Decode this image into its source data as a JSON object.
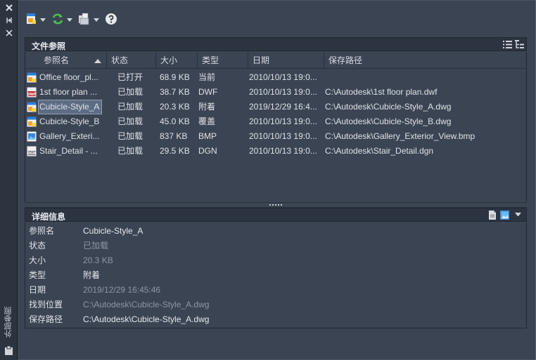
{
  "palette": {
    "vertical_title": "外部参照",
    "controls": [
      "close-icon",
      "auto-hide-icon",
      "properties-icon"
    ]
  },
  "toolbar": {
    "buttons": [
      "attach-icon",
      "refresh-icon",
      "change-path-icon",
      "help-icon"
    ]
  },
  "file_references": {
    "title": "文件参照",
    "columns": [
      "参照名",
      "状态",
      "大小",
      "类型",
      "日期",
      "保存路径"
    ],
    "sort_column": "参照名",
    "rows": [
      {
        "icon": "dwg-current-icon",
        "name": "Office floor_pl...",
        "status": "已打开",
        "size": "68.9 KB",
        "type": "当前",
        "date": "2010/10/13 19:0...",
        "path": ""
      },
      {
        "icon": "dwf-icon",
        "name": "1st floor plan ...",
        "status": "已加载",
        "size": "38.7 KB",
        "type": "DWF",
        "date": "2010/10/13 19:0...",
        "path": "C:\\Autodesk\\1st floor plan.dwf"
      },
      {
        "icon": "dwg-xref-icon",
        "name": "Cubicle-Style_A",
        "status": "已加载",
        "size": "20.3 KB",
        "type": "附着",
        "date": "2019/12/29 16:4...",
        "path": "C:\\Autodesk\\Cubicle-Style_A.dwg",
        "selected": true
      },
      {
        "icon": "dwg-xref-icon",
        "name": "Cubicle-Style_B",
        "status": "已加载",
        "size": "45.0 KB",
        "type": "覆盖",
        "date": "2010/10/13 19:0...",
        "path": "C:\\Autodesk\\Cubicle-Style_B.dwg"
      },
      {
        "icon": "image-icon",
        "name": "Gallery_Exteri...",
        "status": "已加载",
        "size": "837 KB",
        "type": "BMP",
        "date": "2010/10/13 19:0...",
        "path": "C:\\Autodesk\\Gallery_Exterior_View.bmp"
      },
      {
        "icon": "dgn-icon",
        "name": "Stair_Detail - ...",
        "status": "已加载",
        "size": "29.5 KB",
        "type": "DGN",
        "date": "2010/10/13 19:0...",
        "path": "C:\\Autodesk\\Stair_Detail.dgn"
      }
    ]
  },
  "details": {
    "title": "详细信息",
    "rows": [
      {
        "label": "参照名",
        "value": "Cubicle-Style_A",
        "style": "bright"
      },
      {
        "label": "状态",
        "value": "已加载",
        "style": "dim"
      },
      {
        "label": "大小",
        "value": "20.3 KB",
        "style": "dim"
      },
      {
        "label": "类型",
        "value": "附着",
        "style": "bright"
      },
      {
        "label": "日期",
        "value": "2019/12/29 16:45:46",
        "style": "dim"
      },
      {
        "label": "找到位置",
        "value": "C:\\Autodesk\\Cubicle-Style_A.dwg",
        "style": "dim"
      },
      {
        "label": "保存路径",
        "value": "C:\\Autodesk\\Cubicle-Style_A.dwg",
        "style": "bright"
      }
    ]
  },
  "colors": {
    "panel": "#3b4453",
    "header": "#2c3441",
    "selection": "#5d6c84"
  }
}
